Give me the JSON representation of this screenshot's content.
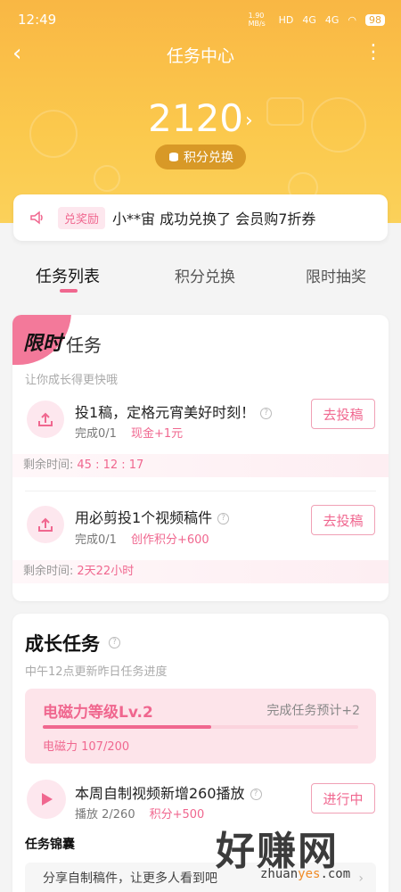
{
  "status_bar": {
    "time": "12:49",
    "net_speed": "1.90 MB/s",
    "hd": "HD",
    "signal1": "4G",
    "signal2": "4G",
    "battery": "98"
  },
  "nav": {
    "title": "任务中心"
  },
  "points": {
    "value": "2120",
    "exchange_label": "积分兑换"
  },
  "ticker": {
    "badge": "兑奖励",
    "message": "小**宙 成功兑换了 会员购7折券"
  },
  "tabs": [
    "任务列表",
    "积分兑换",
    "限时抽奖"
  ],
  "limited_card": {
    "corner_label": "限时",
    "title": "任务",
    "subtitle": "让你成长得更快哦",
    "tasks": [
      {
        "title": "投1稿，定格元宵美好时刻！",
        "progress": "完成0/1",
        "reward": "现金+1元",
        "button": "去投稿",
        "remain_label": "剩余时间:",
        "remain_value": "45 : 12 : 17"
      },
      {
        "title": "用必剪投1个视频稿件",
        "progress": "完成0/1",
        "reward": "创作积分+600",
        "button": "去投稿",
        "remain_label": "剩余时间:",
        "remain_value": "2天22小时"
      }
    ]
  },
  "growth_card": {
    "title": "成长任务",
    "subtitle": "中午12点更新昨日任务进度",
    "level": {
      "title": "电磁力等级Lv.2",
      "hint": "完成任务预计+2",
      "value_label": "电磁力 107/200",
      "progress": 0.535
    },
    "task": {
      "title": "本周自制视频新增260播放",
      "progress": "播放 2/260",
      "reward": "积分+500",
      "button": "进行中"
    },
    "bag_title": "任务锦囊",
    "share_row": "分享自制稿件，让更多人看到吧"
  },
  "watermark": {
    "big": "好赚网",
    "small_a": "zhuan",
    "small_b": "yes",
    "small_c": ".com"
  },
  "colors": {
    "accent": "#f0678f",
    "hero": "#fbc94d"
  }
}
